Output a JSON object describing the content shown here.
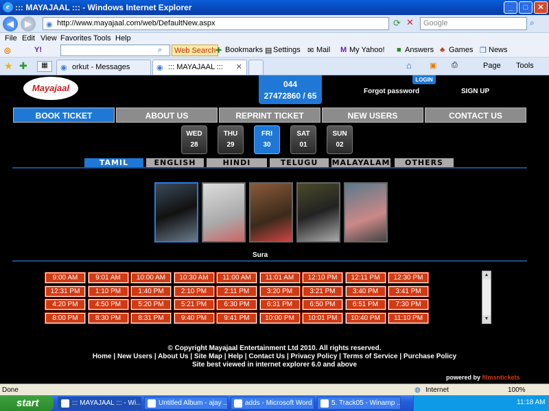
{
  "window": {
    "title": "::: MAYAJAAL ::: - Windows Internet Explorer",
    "minimize": "_",
    "maximize": "□",
    "close": "✕"
  },
  "address": {
    "url": "http://www.mayajaal.com/web/DefaultNew.aspx",
    "search_placeholder": "Google"
  },
  "menu": [
    "File",
    "Edit",
    "View",
    "Favorites",
    "Tools",
    "Help"
  ],
  "toolbar": {
    "web_search": "Web Search",
    "bookmarks": "Bookmarks",
    "settings": "Settings",
    "mail": "Mail",
    "my_yahoo": "My Yahoo!",
    "answers": "Answers",
    "games": "Games",
    "news": "News"
  },
  "tabs": [
    {
      "label": "orkut - Messages"
    },
    {
      "label": "::: MAYAJAAL :::"
    }
  ],
  "commands": {
    "page": "Page",
    "tools": "Tools"
  },
  "site": {
    "logo": "Mayajaal",
    "phone_line1": "044",
    "phone_line2": "27472860 / 65",
    "login": "LOGIN",
    "forgot": "Forgot password",
    "signup": "SIGN UP",
    "main_tabs": [
      "BOOK TICKET",
      "ABOUT US",
      "REPRINT TICKET",
      "NEW USERS",
      "CONTACT US"
    ],
    "days": [
      {
        "dow": "WED",
        "date": "28"
      },
      {
        "dow": "THU",
        "date": "29"
      },
      {
        "dow": "FRI",
        "date": "30"
      },
      {
        "dow": "SAT",
        "date": "01"
      },
      {
        "dow": "SUN",
        "date": "02"
      }
    ],
    "languages": [
      "TAMIL",
      "ENGLISH",
      "HINDI",
      "TELUGU",
      "MALAYALAM",
      "OTHERS"
    ],
    "selected_movie": "Sura",
    "showtimes": [
      [
        "9:00 AM",
        "9:01 AM",
        "10:00 AM",
        "10:30 AM",
        "11:00 AM",
        "11:01 AM",
        "12:10 PM",
        "12:11 PM",
        "12:30 PM"
      ],
      [
        "12:31 PM",
        "1:10 PM",
        "1:40 PM",
        "2:10 PM",
        "2:11 PM",
        "3:20 PM",
        "3:21 PM",
        "3:40 PM",
        "3:41 PM"
      ],
      [
        "4:20 PM",
        "4:50 PM",
        "5:20 PM",
        "5:21 PM",
        "6:30 PM",
        "6:31 PM",
        "6:50 PM",
        "6:51 PM",
        "7:30 PM"
      ],
      [
        "8:00 PM",
        "8:30 PM",
        "8:31 PM",
        "9:40 PM",
        "9:41 PM",
        "10:00 PM",
        "10:01 PM",
        "10:40 PM",
        "11:10 PM"
      ]
    ],
    "footer_copyright": "© Copyright Mayajaal Entertainment Ltd 2010. All rights reserved.",
    "footer_links": "Home | New Users | About Us | Site Map | Help | Contact Us | Privacy Policy | Terms of Service | Purchase Policy",
    "footer_note": "Site best viewed in internet explorer 6.0 and above",
    "powered_prefix": "powered by ",
    "powered_brand": "filmsntickets"
  },
  "status": {
    "text": "Done",
    "zone": "Internet",
    "zoom": "100%"
  },
  "taskbar": {
    "start": "start",
    "tasks": [
      "::: MAYAJAAL ::: - Wi...",
      "Untitled Album - ajay ...",
      "adds - Microsoft Word",
      "5. Track05 - Winamp ..."
    ],
    "clock": "11:18 AM"
  },
  "colors": {
    "accent": "#1f78d6",
    "showtime": "#d23a12",
    "tab_inactive": "#8c8c8c"
  }
}
